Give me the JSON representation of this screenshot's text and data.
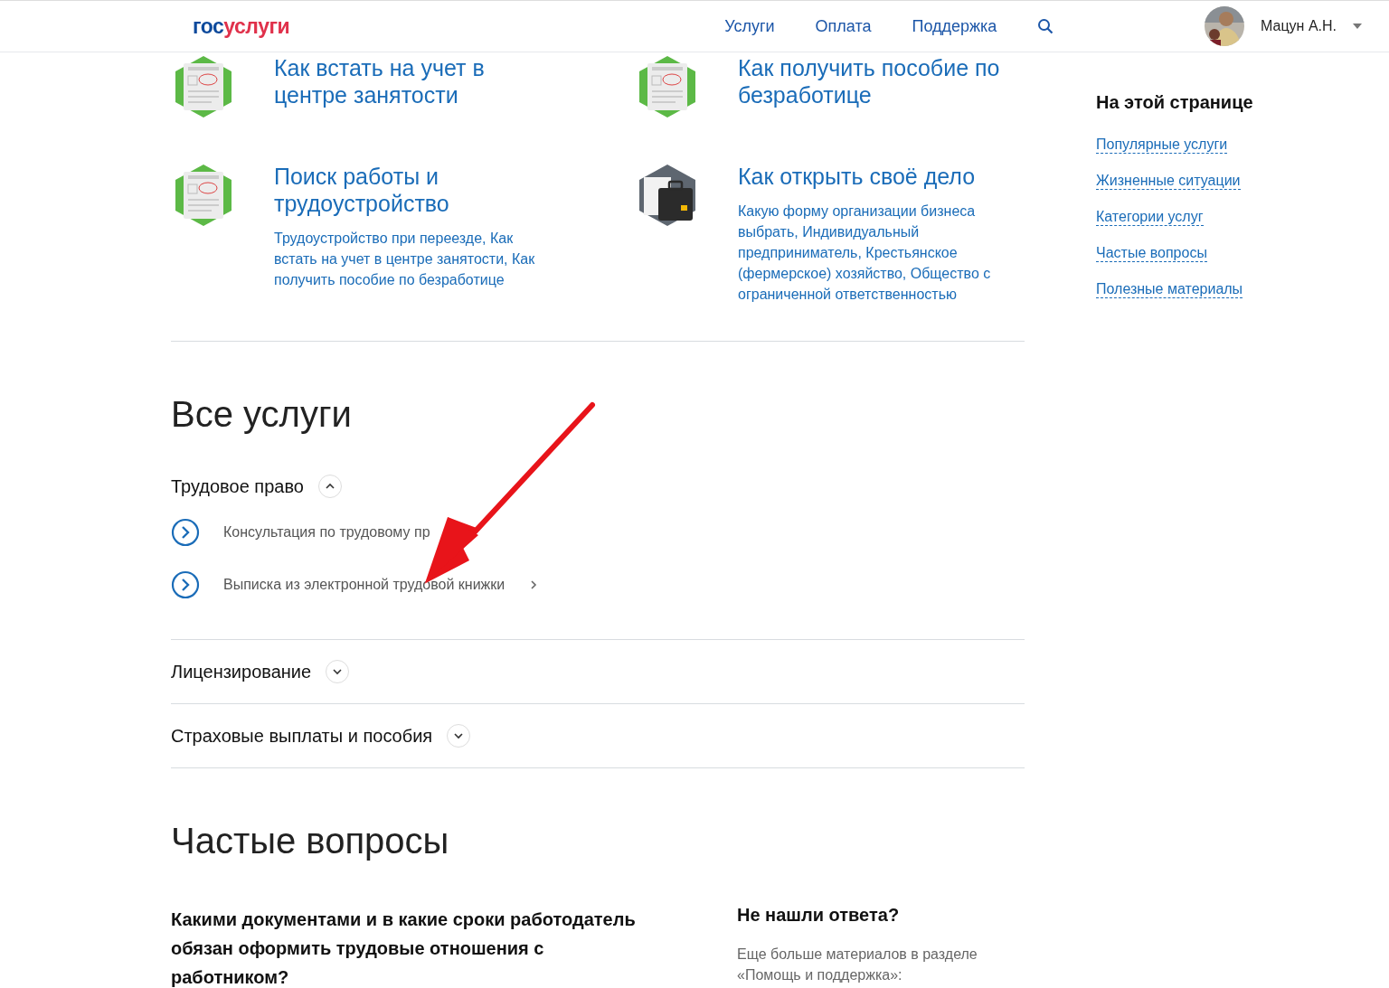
{
  "header": {
    "logo": {
      "first": "гос",
      "second": "услуги"
    },
    "nav": [
      "Услуги",
      "Оплата",
      "Поддержка"
    ],
    "user": "Мацун А.Н."
  },
  "situations": [
    {
      "kind": "document",
      "title": "Как встать на учет в центре занятости"
    },
    {
      "kind": "document",
      "title": "Как получить пособие по безработице"
    },
    {
      "kind": "document",
      "title": "Поиск работы и трудоустройство",
      "description": "Трудоустройство при переезде, Как встать на учет в центре занятости, Как получить пособие по безработице"
    },
    {
      "kind": "briefcase",
      "title": "Как открыть своё дело",
      "description": "Какую форму организации бизнеса выбрать, Индивидуальный предприниматель, Крестьянское (фермерское) хозяйство, Общество с ограниченной ответственностью"
    }
  ],
  "all_services": {
    "title": "Все услуги",
    "groups": [
      {
        "title": "Трудовое право",
        "expanded": true,
        "items": [
          "Консультация по трудовому пр",
          "Выписка из электронной трудовой книжки"
        ]
      },
      {
        "title": "Лицензирование",
        "expanded": false
      },
      {
        "title": "Страховые выплаты и пособия",
        "expanded": false
      }
    ]
  },
  "faq": {
    "title": "Частые вопросы",
    "question": "Какими документами и в какие сроки работодатель обязан оформить трудовые отношения с работником?",
    "help": {
      "title": "Не нашли ответа?",
      "text": "Еще больше материалов в разделе «Помощь и поддержка»:"
    }
  },
  "toc": {
    "title": "На этой странице",
    "links": [
      "Популярные услуги",
      "Жизненные ситуации",
      "Категории услуг",
      "Частые вопросы",
      "Полезные материалы"
    ]
  }
}
